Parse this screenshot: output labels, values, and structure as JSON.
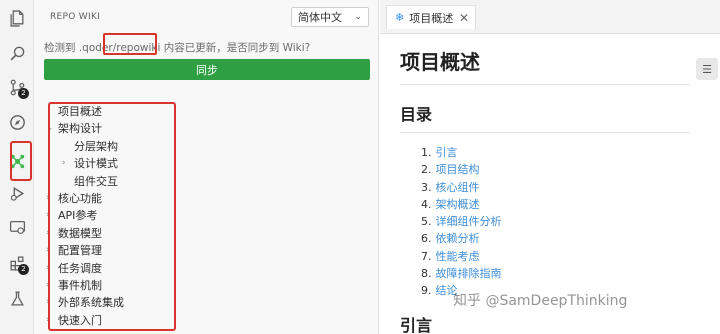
{
  "activity_bar": {
    "items": [
      {
        "icon": "files-icon"
      },
      {
        "icon": "search-icon"
      },
      {
        "icon": "source-control-icon",
        "badge": "2"
      },
      {
        "icon": "compass-icon"
      },
      {
        "icon": "repo-wiki-icon",
        "active": true
      },
      {
        "icon": "run-debug-icon"
      },
      {
        "icon": "remote-icon"
      },
      {
        "icon": "extensions-icon",
        "badge": "2"
      },
      {
        "icon": "flask-icon"
      }
    ]
  },
  "sidebar": {
    "title": "REPO WIKI",
    "language": "简体中文",
    "notice_prefix": "检测到 .qoder/",
    "notice_highlight": "repowiki",
    "notice_suffix": " 内容已更新，是否同步到 Wiki?",
    "sync_label": "同步",
    "tree": [
      {
        "label": "项目概述",
        "level": 0,
        "caret": ""
      },
      {
        "label": "架构设计",
        "level": 0,
        "caret": "⌄"
      },
      {
        "label": "分层架构",
        "level": 1,
        "caret": ""
      },
      {
        "label": "设计模式",
        "level": 1,
        "caret": "›"
      },
      {
        "label": "组件交互",
        "level": 1,
        "caret": ""
      },
      {
        "label": "核心功能",
        "level": 0,
        "caret": "›"
      },
      {
        "label": "API参考",
        "level": 0,
        "caret": "›"
      },
      {
        "label": "数据模型",
        "level": 0,
        "caret": "›"
      },
      {
        "label": "配置管理",
        "level": 0,
        "caret": "›"
      },
      {
        "label": "任务调度",
        "level": 0,
        "caret": "›"
      },
      {
        "label": "事件机制",
        "level": 0,
        "caret": "›"
      },
      {
        "label": "外部系统集成",
        "level": 0,
        "caret": "›"
      },
      {
        "label": "快速入门",
        "level": 0,
        "caret": "›"
      }
    ]
  },
  "editor": {
    "tab_label": "项目概述",
    "tab_icon": "gear-snowflake-icon",
    "doc_title": "项目概述",
    "toc_heading": "目录",
    "toc": [
      {
        "num": "1.",
        "label": "引言"
      },
      {
        "num": "2.",
        "label": "项目结构"
      },
      {
        "num": "3.",
        "label": "核心组件"
      },
      {
        "num": "4.",
        "label": "架构概述"
      },
      {
        "num": "5.",
        "label": "详细组件分析"
      },
      {
        "num": "6.",
        "label": "依赖分析"
      },
      {
        "num": "7.",
        "label": "性能考虑"
      },
      {
        "num": "8.",
        "label": "故障排除指南"
      },
      {
        "num": "9.",
        "label": "结论"
      }
    ],
    "next_heading": "引言"
  },
  "watermark": "知乎 @SamDeepThinking",
  "colors": {
    "accent_green": "#2ea043",
    "highlight_red": "#d9342b",
    "link_blue": "#3c8dd9",
    "active_icon_green": "#3fb950"
  }
}
